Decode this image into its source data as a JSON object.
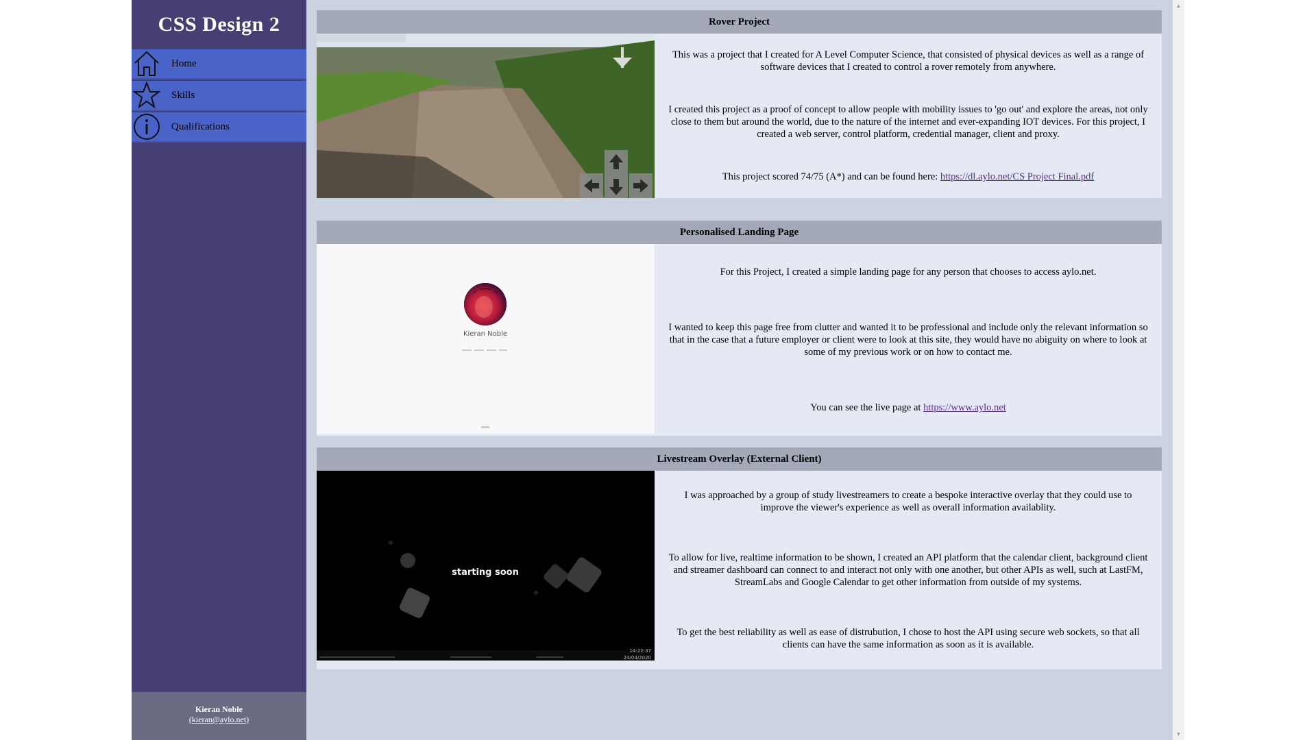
{
  "site": {
    "title": "CSS Design 2"
  },
  "nav": {
    "items": [
      {
        "label": "Home",
        "icon": "home-icon"
      },
      {
        "label": "Skills",
        "icon": "star-icon"
      },
      {
        "label": "Qualifications",
        "icon": "info-icon"
      }
    ]
  },
  "footer": {
    "name": "Kieran Noble",
    "email": "(kieran@aylo.net)"
  },
  "projects": [
    {
      "title": "Rover Project",
      "paragraphs": [
        "This was a project that I created for A Level Computer Science, that consisted of physical devices as well as a range of software devices that I created to control a rover remotely from anywhere.",
        "I created this project as a proof of concept to allow people with mobility issues to 'go out' and explore the areas, not only close to them but around the world, due to the nature of the internet and ever-expanding IOT devices. For this project, I created a web server, control platform, credential manager, client and proxy."
      ],
      "link_prefix": "This project scored 74/75 (A*) and can be found here: ",
      "link_text": "https://dl.aylo.net/CS Project Final.pdf"
    },
    {
      "title": "Personalised Landing Page",
      "paragraphs": [
        "For this Project, I created a simple landing page for any person that chooses to access aylo.net.",
        "I wanted to keep this page free from clutter and wanted it to be professional and include only the relevant information so that in the case that a future employer or client were to look at this site, they would have no abiguity on where to look at some of my previous work or on how to contact me."
      ],
      "link_prefix": "You can see the live page at ",
      "link_text": "https://www.aylo.net",
      "preview_name": "Kieran Noble"
    },
    {
      "title": "Livestream Overlay (External Client)",
      "paragraphs": [
        "I was approached by a group of study livestreamers to create a bespoke interactive overlay that they could use to improve the viewer's experience as well as overall information availablity.",
        "To allow for live, realtime information to be shown, I created an API platform that the calendar client, background client and streamer dashboard can connect to and interact not only with one another, but other APIs as well, such at LastFM, StreamLabs and Google Calendar to get other information from outside of my systems.",
        "To get the best reliability as well as ease of distrubution, I chose to host the API using secure web sockets, so that all clients can have the same information as soon as it is available."
      ],
      "overlay_text": "starting soon",
      "overlay_time": "14:22:37",
      "overlay_date": "24/04/2020"
    }
  ]
}
